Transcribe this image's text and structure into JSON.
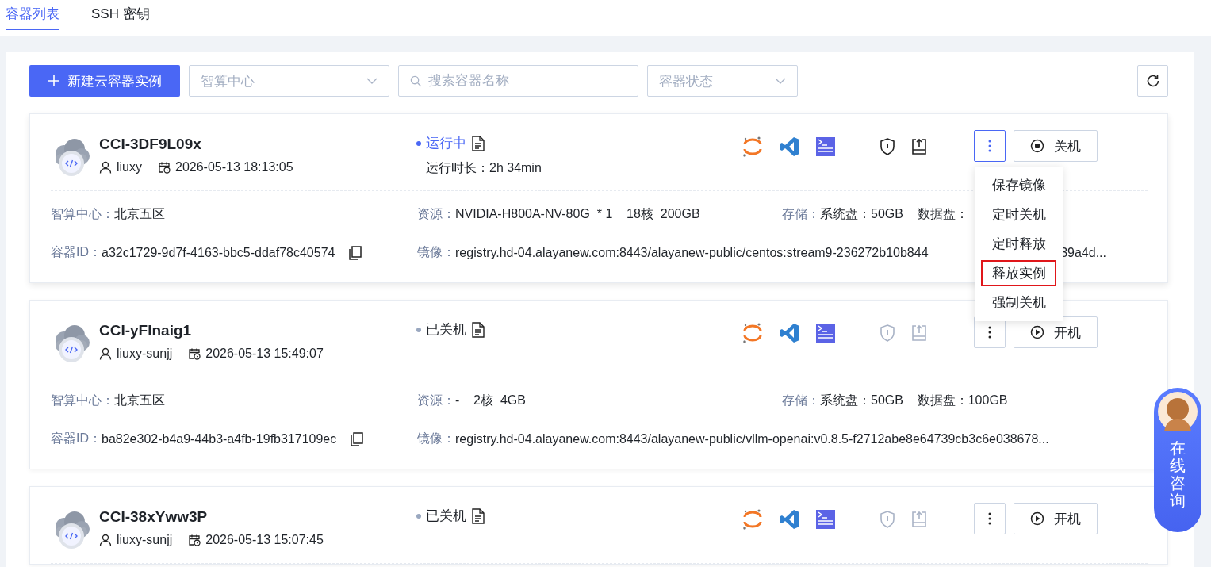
{
  "tabs": [
    {
      "label": "容器列表",
      "selected": true
    },
    {
      "label": "SSH 密钥",
      "selected": false
    }
  ],
  "toolbar": {
    "create_button": "新建云容器实例",
    "center_select": {
      "placeholder": "智算中心"
    },
    "search": {
      "placeholder": "搜索容器名称"
    },
    "status_select": {
      "placeholder": "容器状态"
    }
  },
  "containers": [
    {
      "name": "CCI-3DF9L09x",
      "user": "liuxy",
      "created": "2026-05-13 18:13:05",
      "status": {
        "kind": "running",
        "label": "运行中"
      },
      "runtime": {
        "label": "运行时长：",
        "value": "2h 34min"
      },
      "tools_enabled": true,
      "more_expanded": true,
      "power": {
        "kind": "stop",
        "label": "关机"
      },
      "fields": [
        {
          "label": "智算中心：",
          "value": "北京五区"
        },
        {
          "label": "资源：",
          "value": "NVIDIA-H800A-NV-80G  * 1    18核  200GB"
        },
        {
          "label": "存储：",
          "value": "系统盘：50GB    数据盘："
        },
        {
          "label": "容器ID：",
          "value": "a32c1729-9d7f-4163-bbc5-ddaf78c40574",
          "copy": true
        },
        {
          "label": "镜像：",
          "value": "registry.hd-04.alayanew.com:8443/alayanew-public/centos:stream9-236272b10b844",
          "tail": "39a4d..."
        }
      ]
    },
    {
      "name": "CCI-yFInaig1",
      "user": "liuxy-sunjj",
      "created": "2026-05-13 15:49:07",
      "status": {
        "kind": "stopped",
        "label": "已关机"
      },
      "tools_enabled": false,
      "more_expanded": false,
      "power": {
        "kind": "start",
        "label": "开机"
      },
      "fields": [
        {
          "label": "智算中心：",
          "value": "北京五区"
        },
        {
          "label": "资源：",
          "value": "-    2核  4GB"
        },
        {
          "label": "存储：",
          "value": "系统盘：50GB    数据盘：100GB"
        },
        {
          "label": "容器ID：",
          "value": "ba82e302-b4a9-44b3-a4fb-19fb317109ec",
          "copy": true
        },
        {
          "label": "镜像：",
          "value": "registry.hd-04.alayanew.com:8443/alayanew-public/vllm-openai:v0.8.5-f2712abe8e64739cb3c6e038678..."
        }
      ]
    },
    {
      "name": "CCI-38xYww3P",
      "user": "liuxy-sunjj",
      "created": "2026-05-13 15:07:45",
      "status": {
        "kind": "stopped",
        "label": "已关机"
      },
      "tools_enabled": false,
      "more_expanded": false,
      "power": {
        "kind": "start",
        "label": "开机"
      }
    }
  ],
  "more_menu": {
    "items": [
      {
        "label": "保存镜像",
        "highlighted": false
      },
      {
        "label": "定时关机",
        "highlighted": false
      },
      {
        "label": "定时释放",
        "highlighted": false
      },
      {
        "label": "释放实例",
        "highlighted": true
      },
      {
        "label": "强制关机",
        "highlighted": false
      }
    ]
  },
  "chat_widget": {
    "label": "在线咨询"
  }
}
